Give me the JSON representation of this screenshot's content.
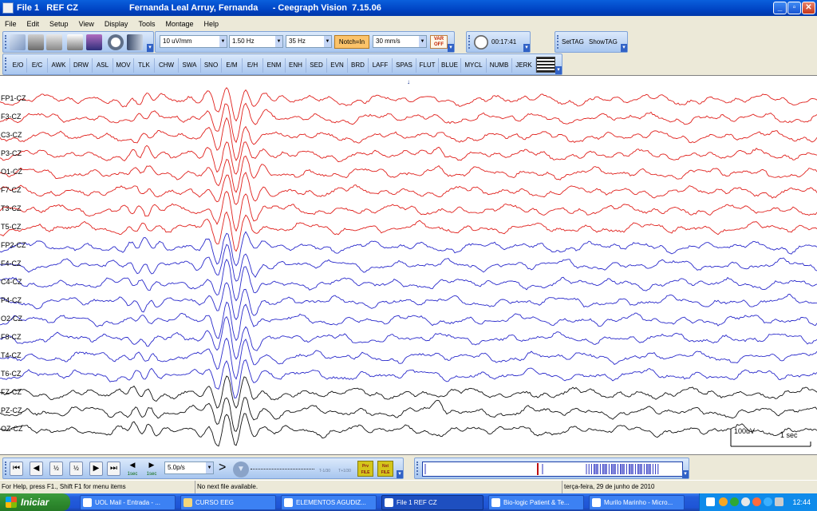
{
  "window": {
    "title_left": "File 1   REF CZ",
    "title_center": "Fernanda Leal Arruy, Fernanda      - Ceegraph Vision  7.15.06"
  },
  "menu": [
    "File",
    "Edit",
    "Setup",
    "View",
    "Display",
    "Tools",
    "Montage",
    "Help"
  ],
  "toolbar": {
    "sensitivity": "10 uV/mm",
    "low_filter": "1.50 Hz",
    "high_filter": "35 Hz",
    "notch": "Notch=In",
    "speed": "30 mm/s",
    "var": "VAR OFF",
    "timer": "00:17:41",
    "settag": "SetTAG",
    "showtag": "ShowTAG"
  },
  "events": [
    "E/O",
    "E/C",
    "AWK",
    "DRW",
    "ASL",
    "MOV",
    "TLK",
    "CHW",
    "SWA",
    "SNO",
    "E/M",
    "E/H",
    "ENM",
    "ENH",
    "SED",
    "EVN",
    "BRD",
    "LAFF",
    "SPAS",
    "FLUT",
    "BLUE",
    "MYCL",
    "NUMB",
    "JERK"
  ],
  "channels": [
    {
      "label": "FP1-CZ",
      "color": "#e0201c"
    },
    {
      "label": "F3-CZ",
      "color": "#e0201c"
    },
    {
      "label": "C3-CZ",
      "color": "#e0201c"
    },
    {
      "label": "P3-CZ",
      "color": "#e0201c"
    },
    {
      "label": "O1-CZ",
      "color": "#e0201c"
    },
    {
      "label": "F7-CZ",
      "color": "#e0201c"
    },
    {
      "label": "T3-CZ",
      "color": "#e0201c"
    },
    {
      "label": "T5-CZ",
      "color": "#e0201c"
    },
    {
      "label": "FP2-CZ",
      "color": "#2a2acb"
    },
    {
      "label": "F4-CZ",
      "color": "#2a2acb"
    },
    {
      "label": "C4-CZ",
      "color": "#2a2acb"
    },
    {
      "label": "P4-CZ",
      "color": "#2a2acb"
    },
    {
      "label": "O2-CZ",
      "color": "#2a2acb"
    },
    {
      "label": "F8-CZ",
      "color": "#2a2acb"
    },
    {
      "label": "T4-CZ",
      "color": "#2a2acb"
    },
    {
      "label": "T6-CZ",
      "color": "#2a2acb"
    },
    {
      "label": "FZ-CZ",
      "color": "#111111"
    },
    {
      "label": "PZ-CZ",
      "color": "#111111"
    },
    {
      "label": "OZ-CZ",
      "color": "#111111"
    }
  ],
  "scale": {
    "amplitude": "100uV",
    "time": "1 sec"
  },
  "playback": {
    "step_back": "1sec",
    "step_fwd": "1sec",
    "rate": "5.0p/s",
    "minus": "T-1/30",
    "plus": "T+1/30",
    "prev_file": "Prv FILE",
    "next_file": "Nxt FILE"
  },
  "status": {
    "help": "For Help, press F1., Shift F1 for menu items",
    "file": "No next file available.",
    "date": "terça-feira, 29 de junho de 2010"
  },
  "taskbar": {
    "start": "Iniciar",
    "tasks": [
      "UOL Mail - Entrada - ...",
      "CURSO EEG",
      "ELEMENTOS AGUDIZ...",
      "File 1   REF CZ",
      "Bio-logic Patient & Te...",
      "Murilo Marinho - Micro..."
    ],
    "clock": "12:44"
  }
}
